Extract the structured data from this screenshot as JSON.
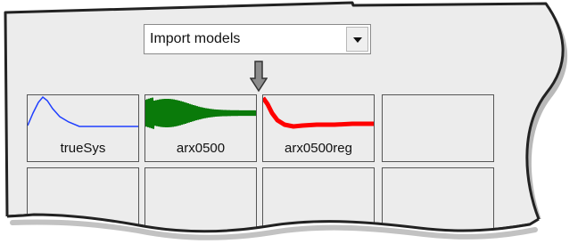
{
  "model_board": {
    "import_dropdown": {
      "selected": "Import models",
      "icon": "chevron-down-icon"
    },
    "insert_indicator_icon": "down-arrow-icon",
    "tiles": [
      {
        "label": "trueSys",
        "trace_color": "#1f3fff"
      },
      {
        "label": "arx0500",
        "trace_color": "#0a7a0a"
      },
      {
        "label": "arx0500reg",
        "trace_color": "#ff0000"
      },
      {
        "label": ""
      },
      {
        "label": ""
      },
      {
        "label": ""
      },
      {
        "label": ""
      },
      {
        "label": ""
      }
    ]
  }
}
